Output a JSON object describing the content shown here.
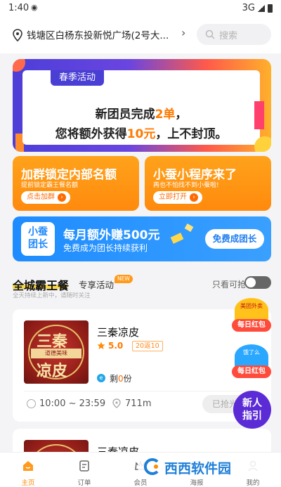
{
  "status_bar": {
    "time": "1:40",
    "network": "3G"
  },
  "header": {
    "address": "钱塘区白杨东投新悦广场(2号大...",
    "search_placeholder": "搜索"
  },
  "banner": {
    "tag": "春季活动",
    "line1_a": "新团员完成",
    "line1_b": "2单",
    "line1_c": "，",
    "line2_a": "您将额外获得",
    "line2_b": "10元",
    "line2_c": "，上不封顶。"
  },
  "promos": [
    {
      "title": "加群锁定内部名额",
      "subtitle": "提前锁定霸王餐名额",
      "button": "点击加群"
    },
    {
      "title": "小蚕小程序来了",
      "subtitle": "再也不怕找不到小蚕啦!",
      "button": "立即打开"
    }
  ],
  "leader": {
    "badge_l1": "小蚕",
    "badge_l2": "团长",
    "title": "每月额外赚500元",
    "subtitle": "免费成为团长持续获利",
    "button": "免费成团长"
  },
  "section": {
    "title": "全城霸王餐",
    "subtitle": "全天持续上新中，请随时关注",
    "tab": "专享活动",
    "new_badge": "NEW",
    "filter_label": "只看可抢",
    "filter_on": false
  },
  "listings": [
    {
      "name": "三秦凉皮",
      "rating": "5.0",
      "sales": "20返10",
      "remain_a": "剩",
      "remain_b": "0",
      "remain_c": "份",
      "hours": "10:00 ~ 23:59",
      "distance": "711m",
      "button": "已抢光",
      "thumb_top": "三秦",
      "thumb_ribbon": "道德美味",
      "thumb_bottom": "凉皮"
    },
    {
      "name": "三秦凉皮"
    }
  ],
  "floating": [
    {
      "brand": "美团外卖",
      "label": "每日红包"
    },
    {
      "brand": "饿了么",
      "label": "每日红包"
    }
  ],
  "guide_button": {
    "line1": "新人",
    "line2": "指引"
  },
  "tabbar": [
    {
      "label": "主页",
      "active": true
    },
    {
      "label": "订单",
      "active": false
    },
    {
      "label": "会员",
      "active": false
    },
    {
      "label": "海报",
      "active": false
    },
    {
      "label": "我的",
      "active": false
    }
  ],
  "watermark": {
    "text": "西西软件园"
  },
  "colors": {
    "accent": "#ff8a00",
    "blue": "#1e8cff",
    "purple": "#5b2bd6",
    "red": "#ff4b3b"
  }
}
